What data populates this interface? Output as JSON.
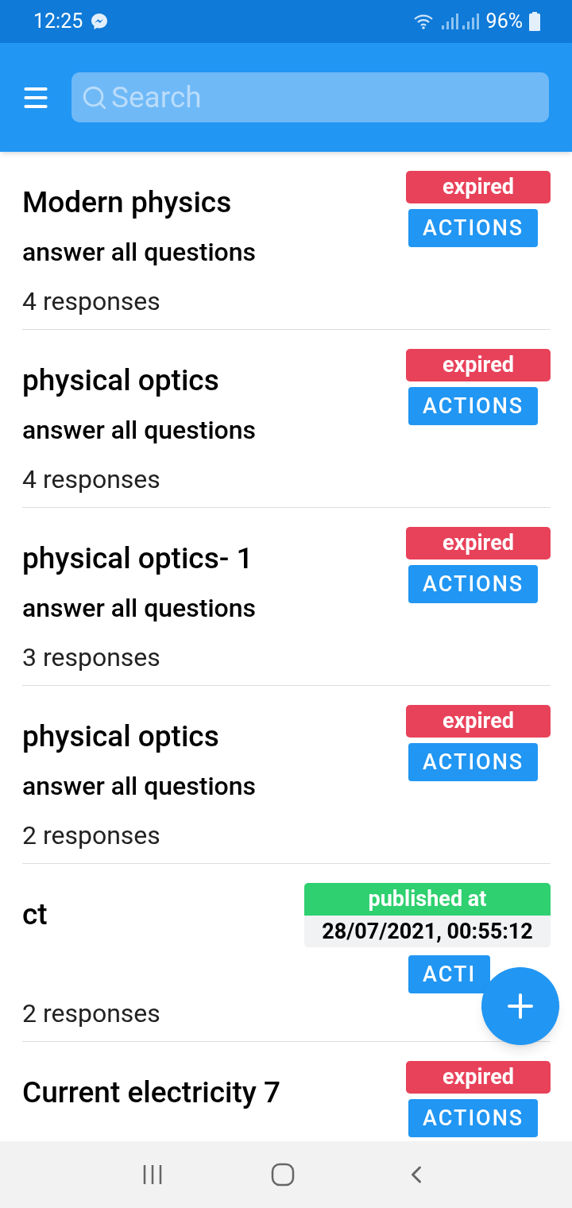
{
  "status_bar": {
    "time": "12:25",
    "battery": "96%"
  },
  "header": {
    "search": {
      "placeholder": "Search"
    }
  },
  "forms": [
    {
      "title": "Modern physics",
      "subtitle": "answer all questions",
      "responses": "4 responses",
      "status": {
        "kind": "expired",
        "label": "expired"
      },
      "action": "ACTIONS"
    },
    {
      "title": "physical optics",
      "subtitle": "answer all questions",
      "responses": "4 responses",
      "status": {
        "kind": "expired",
        "label": "expired"
      },
      "action": "ACTIONS"
    },
    {
      "title": "physical optics- 1",
      "subtitle": "answer all questions",
      "responses": "3 responses",
      "status": {
        "kind": "expired",
        "label": "expired"
      },
      "action": "ACTIONS"
    },
    {
      "title": "physical optics",
      "subtitle": "answer all questions",
      "responses": "2 responses",
      "status": {
        "kind": "expired",
        "label": "expired"
      },
      "action": "ACTIONS"
    },
    {
      "title": "ct",
      "responses": "2 responses",
      "status": {
        "kind": "published",
        "label": "published at",
        "date": "28/07/2021, 00:55:12"
      },
      "action": "ACTI"
    },
    {
      "title": "Current electricity 7",
      "status": {
        "kind": "expired",
        "label": "expired"
      },
      "action": "ACTIONS"
    }
  ]
}
